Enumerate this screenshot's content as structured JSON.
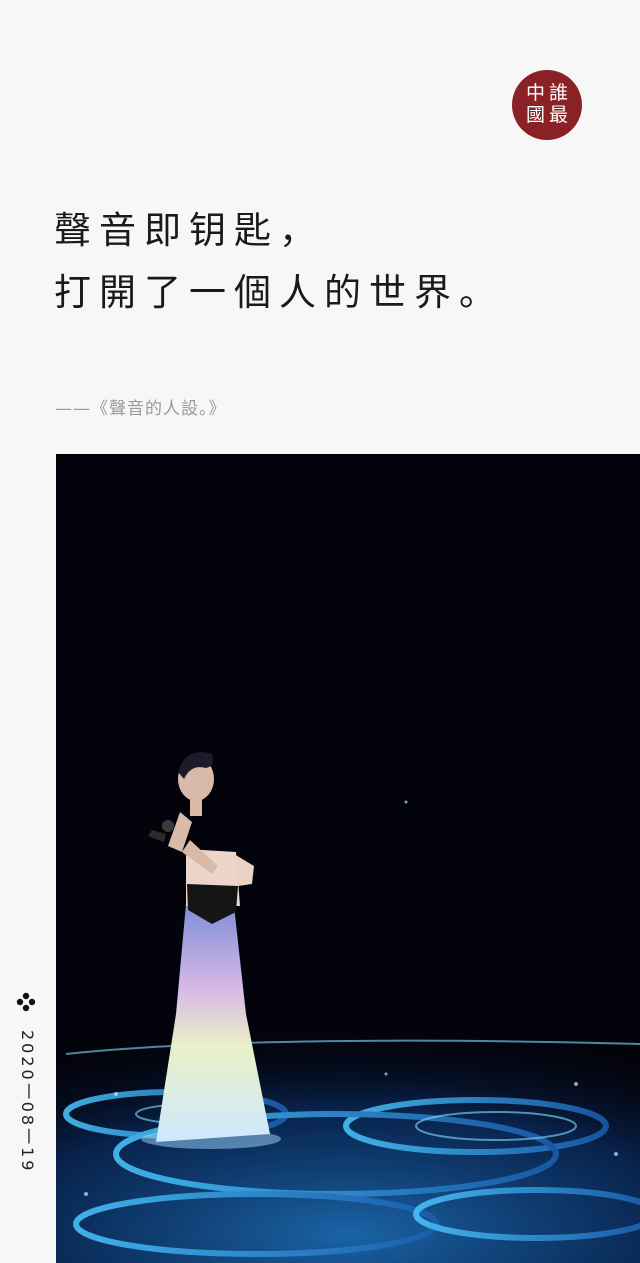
{
  "logo": {
    "chars": [
      "中",
      "誰",
      "國",
      "最"
    ]
  },
  "quote": {
    "line1": "聲音即钥匙，",
    "line2": "打開了一個人的世界。"
  },
  "source": "——《聲音的人設。》",
  "side": {
    "icon": "clover-icon",
    "date": "2020丨08丨19"
  },
  "colors": {
    "background": "#f7f7f7",
    "seal": "#8a2126",
    "stage": "#03030c",
    "floor_light": "#2a8fd8"
  }
}
